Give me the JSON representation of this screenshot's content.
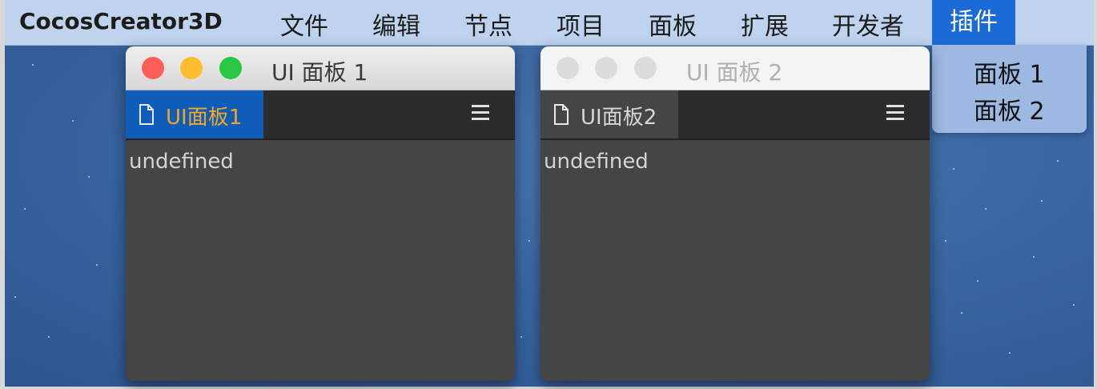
{
  "menubar": {
    "app_name": "CocosCreator3D",
    "items": [
      "文件",
      "编辑",
      "节点",
      "项目",
      "面板",
      "扩展",
      "开发者",
      "插件"
    ],
    "active_item": "插件"
  },
  "dropdown": {
    "items": [
      "面板 1",
      "面板 2"
    ]
  },
  "windows": [
    {
      "title": "UI 面板 1",
      "focused": true,
      "tab_label": "UI面板1",
      "tab_color": "#f5a623",
      "content_text": "undefined"
    },
    {
      "title": "UI 面板 2",
      "focused": false,
      "tab_label": "UI面板2",
      "tab_color": "#d6d6d6",
      "content_text": "undefined"
    }
  ],
  "colors": {
    "menubar_bg": "#bfd3ee",
    "menu_active_bg": "#1a6bd6",
    "desktop_bg": "#3a66a3",
    "panel_bg": "#454545",
    "close_red": "#fe5f57",
    "minimize_yellow": "#febc2e",
    "zoom_green": "#28c840"
  },
  "icons": {
    "tab_icon": "document-icon",
    "tab_menu": "hamburger-menu-icon"
  }
}
